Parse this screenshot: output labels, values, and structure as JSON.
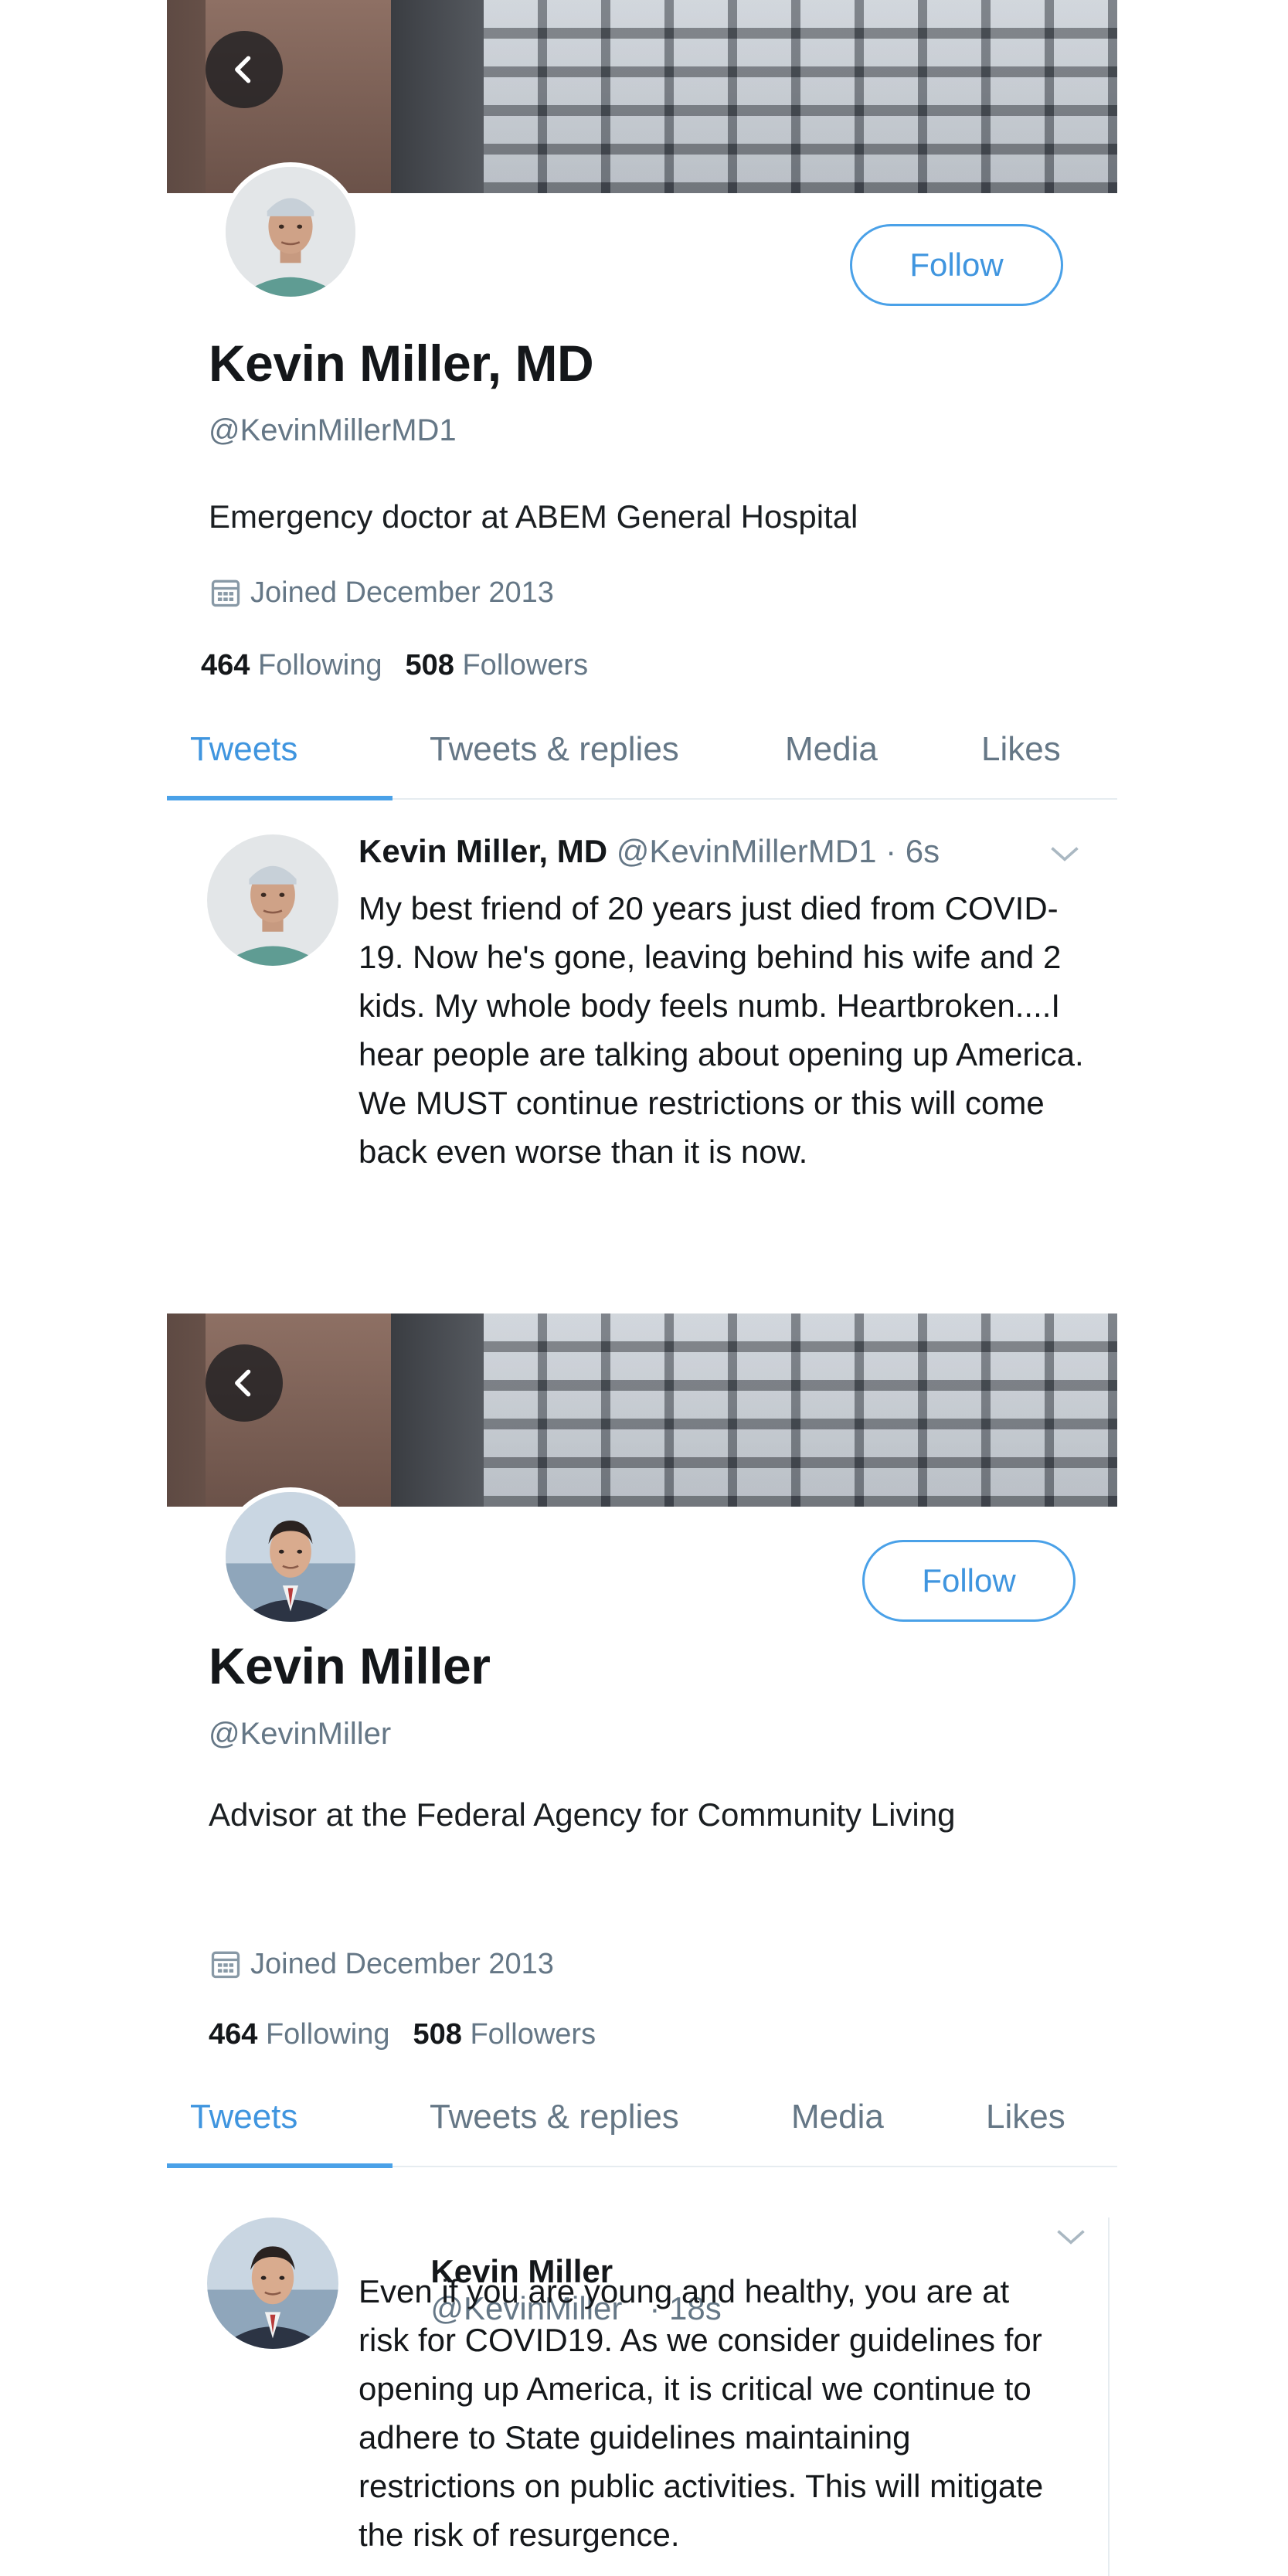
{
  "profiles": [
    {
      "follow_label": "Follow",
      "name": "Kevin Miller, MD",
      "handle": "@KevinMillerMD1",
      "bio": "Emergency doctor at ABEM General Hospital",
      "joined": "Joined December 2013",
      "following_count": "464",
      "following_label": "Following",
      "followers_count": "508",
      "followers_label": "Followers",
      "tabs": [
        "Tweets",
        "Tweets & replies",
        "Media",
        "Likes"
      ],
      "active_tab": "Tweets",
      "tweet": {
        "name": "Kevin Miller, MD",
        "handle_time": "@KevinMillerMD1 · 6s",
        "text": "My best friend of 20 years just died from COVID-19. Now he's gone, leaving behind his wife and 2 kids. My whole body feels numb. Heartbroken....I hear people are talking about opening up America. We MUST continue restrictions or this will come back even worse than it is now."
      }
    },
    {
      "follow_label": "Follow",
      "name": "Kevin Miller",
      "handle": "@KevinMiller",
      "bio": "Advisor at the Federal Agency for Community Living",
      "joined": "Joined December 2013",
      "following_count": "464",
      "following_label": "Following",
      "followers_count": "508",
      "followers_label": "Followers",
      "tabs": [
        "Tweets",
        "Tweets & replies",
        "Media",
        "Likes"
      ],
      "active_tab": "Tweets",
      "tweet": {
        "name": "Kevin Miller",
        "handle_time": "@KevinMiller   · 18s",
        "text": "Even if you are young and healthy, you are at risk for COVID19. As we consider guidelines for opening up America, it is critical we continue to adhere to State guidelines maintaining restrictions on public activities. This will mitigate the risk of resurgence."
      }
    }
  ],
  "colors": {
    "accent": "#3f95df",
    "text_primary": "#14171a",
    "text_secondary": "#657786",
    "divider": "#e6ecf0"
  },
  "icons": [
    "chevron-left-icon",
    "calendar-icon",
    "chevron-down-icon"
  ]
}
